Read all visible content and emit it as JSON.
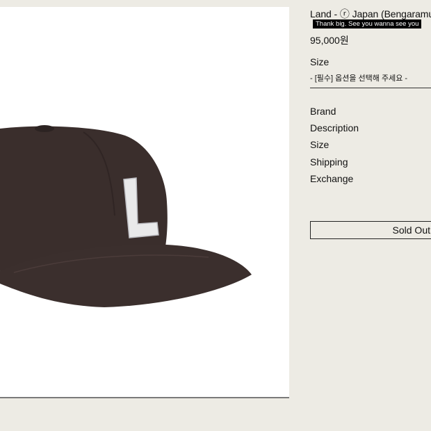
{
  "product": {
    "title": "Land - ⓡ Japan (Bengaramud)",
    "promo": "Thank big. See you wanna see you",
    "price": "95,000원"
  },
  "options": {
    "size_label": "Size",
    "size_select_placeholder": "- [필수] 옵션을 선택해 주세요 -"
  },
  "menu": {
    "items": [
      "Brand",
      "Description",
      "Size",
      "Shipping",
      "Exchange"
    ]
  },
  "actions": {
    "sold_out": "Sold Out"
  },
  "image": {
    "icon": "baseball-cap-image",
    "cap_color": "#3a2e2c",
    "letter_color": "#e9e9ea",
    "letter": "L"
  }
}
